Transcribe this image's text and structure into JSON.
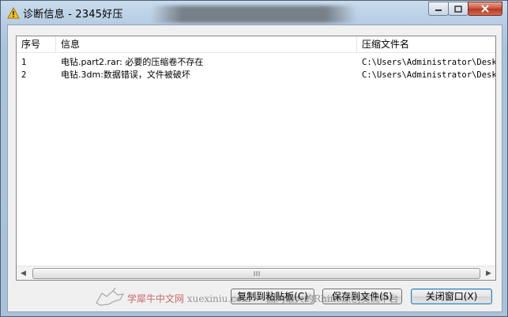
{
  "window": {
    "title": "诊断信息 - 2345好压"
  },
  "list": {
    "columns": [
      "序号",
      "信息",
      "压缩文件名"
    ],
    "rows": [
      {
        "index": "1",
        "info": "电钻.part2.rar: 必要的压缩卷不存在",
        "archive": "C:\\Users\\Administrator\\Deskt"
      },
      {
        "index": "2",
        "info": "电钻.3dm:数据错误，文件被破坏",
        "archive": "C:\\Users\\Administrator\\Deskt"
      }
    ]
  },
  "buttons": {
    "copy": "复制到粘贴板(C)",
    "save": "保存到文件(S)",
    "close": "关闭窗口(X)"
  },
  "watermark": {
    "cn": "学犀牛中文网",
    "url": "xuexiniu.com",
    "slogan": "一 国内最大的Rhino原创交流平台"
  },
  "icons": {
    "title": "warning-icon",
    "minimize": "minimize-icon",
    "maximize": "maximize-icon",
    "close": "close-icon"
  }
}
